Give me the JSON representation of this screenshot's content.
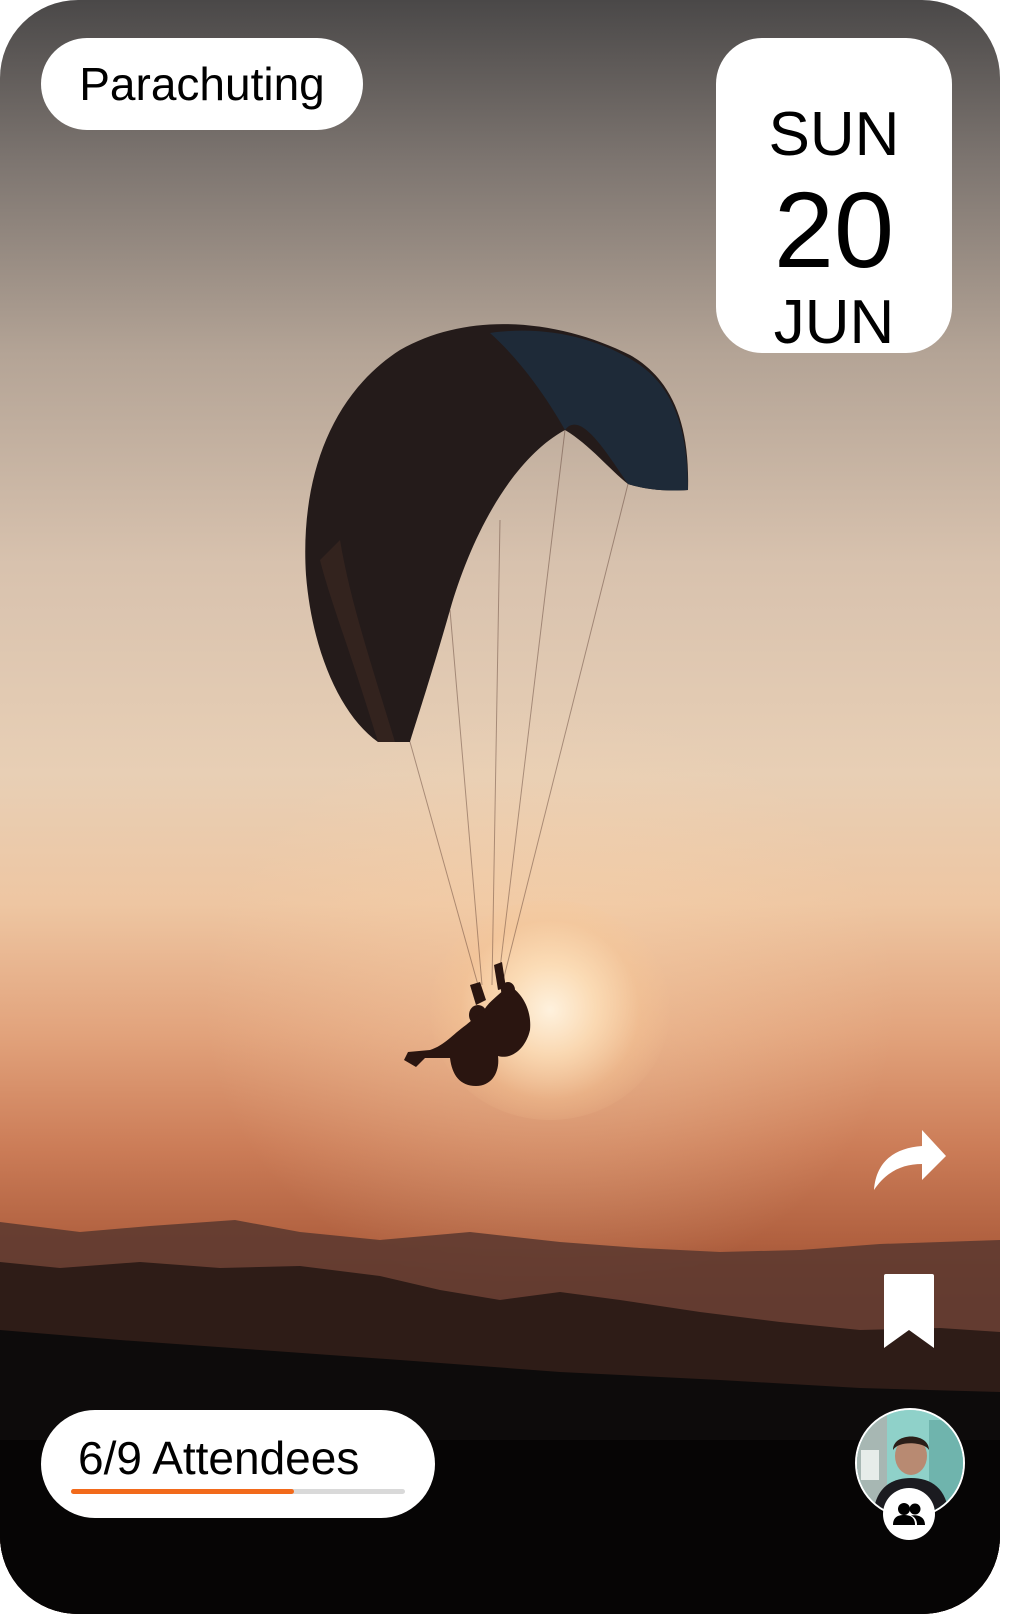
{
  "event": {
    "category": "Parachuting",
    "date": {
      "day_of_week": "SUN",
      "day": "20",
      "month": "JUN"
    },
    "attendees": {
      "label": "6/9 Attendees",
      "current": 6,
      "capacity": 9
    }
  },
  "actions": {
    "share_icon": "share-arrow-icon",
    "bookmark_icon": "bookmark-icon",
    "group_icon": "group-icon"
  },
  "colors": {
    "progress_fill": "#f26a1b",
    "progress_track": "#d9d9d9",
    "pill_background": "#ffffff"
  }
}
